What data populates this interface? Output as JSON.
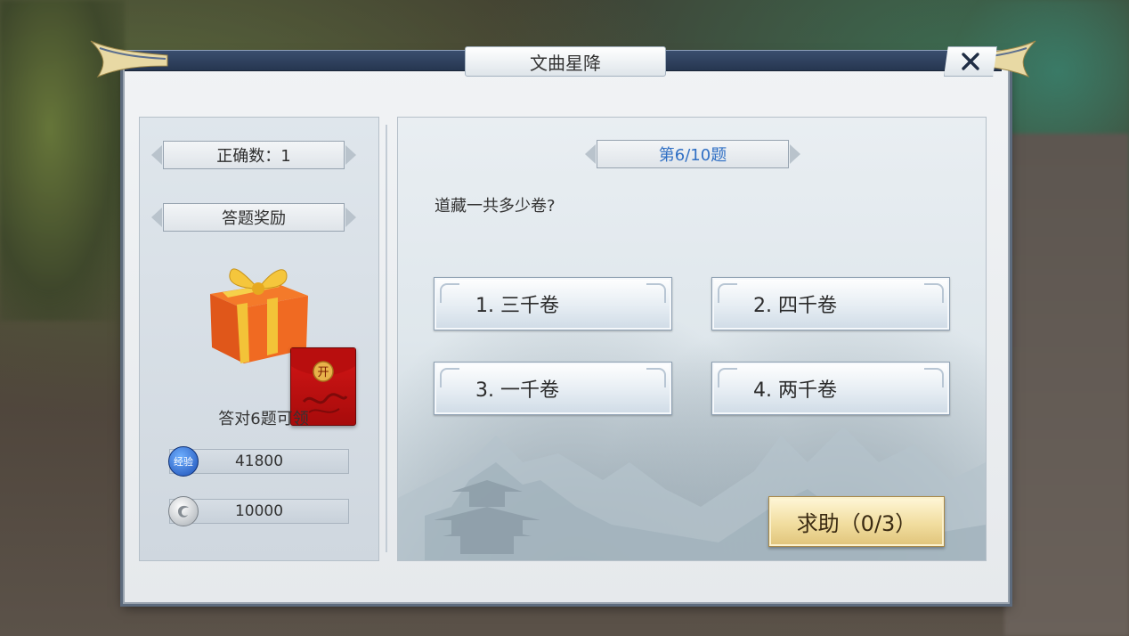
{
  "dialog": {
    "title": "文曲星降",
    "close_icon": "close-icon"
  },
  "left": {
    "correct_count": "正确数：1",
    "reward_header": "答题奖励",
    "reward_text": "答对6题可领",
    "red_packet_char": "开",
    "rewards": [
      {
        "icon": "exp-icon",
        "icon_text": "经验",
        "value": "41800"
      },
      {
        "icon": "silver-coin-icon",
        "value": "10000"
      }
    ]
  },
  "right": {
    "progress": "第6/10题",
    "question": "道藏一共多少卷?",
    "options": [
      {
        "label": "1. 三千卷"
      },
      {
        "label": "2. 四千卷"
      },
      {
        "label": "3. 一千卷"
      },
      {
        "label": "4. 两千卷"
      }
    ],
    "help_button": "求助（0/3）"
  },
  "colors": {
    "progress_text": "#2f6fc4",
    "help_button": "#f1dd9f",
    "red_packet": "#c81212"
  }
}
